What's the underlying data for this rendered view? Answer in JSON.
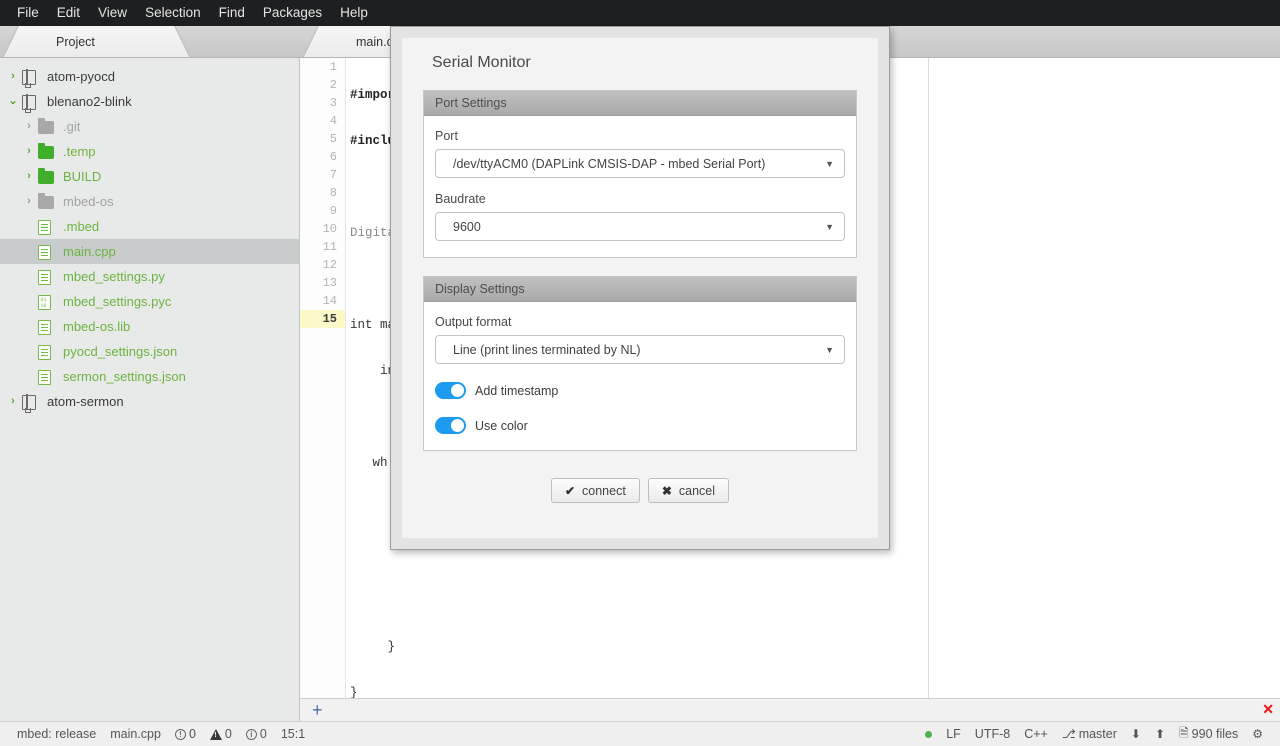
{
  "menubar": {
    "items": [
      {
        "label": "File"
      },
      {
        "label": "Edit"
      },
      {
        "label": "View"
      },
      {
        "label": "Selection"
      },
      {
        "label": "Find"
      },
      {
        "label": "Packages"
      },
      {
        "label": "Help"
      }
    ]
  },
  "left_tab": {
    "label": "Project"
  },
  "editor_tab": {
    "label": "main.cpp"
  },
  "sidebar": {
    "items": [
      {
        "label": "atom-pyocd",
        "icon": "repo-icon",
        "twisty": "›",
        "depth": 0,
        "style": "dark",
        "selected": false
      },
      {
        "label": "blenano2-blink",
        "icon": "repo-icon",
        "twisty": "⌄",
        "depth": 0,
        "style": "dark",
        "selected": false
      },
      {
        "label": ".git",
        "icon": "folder-grey-icon",
        "twisty": "›",
        "depth": 1,
        "style": "grey",
        "selected": false
      },
      {
        "label": ".temp",
        "icon": "folder-icon",
        "twisty": "›",
        "depth": 1,
        "style": "green",
        "selected": false
      },
      {
        "label": "BUILD",
        "icon": "folder-icon",
        "twisty": "›",
        "depth": 1,
        "style": "green",
        "selected": false
      },
      {
        "label": "mbed-os",
        "icon": "folder-grey-icon",
        "twisty": "›",
        "depth": 1,
        "style": "grey",
        "selected": false
      },
      {
        "label": ".mbed",
        "icon": "file-icon",
        "twisty": "",
        "depth": 1,
        "style": "green",
        "selected": false
      },
      {
        "label": "main.cpp",
        "icon": "file-icon",
        "twisty": "",
        "depth": 1,
        "style": "green",
        "selected": true
      },
      {
        "label": "mbed_settings.py",
        "icon": "file-icon",
        "twisty": "",
        "depth": 1,
        "style": "green",
        "selected": false
      },
      {
        "label": "mbed_settings.pyc",
        "icon": "file-binary-icon",
        "twisty": "",
        "depth": 1,
        "style": "green",
        "selected": false
      },
      {
        "label": "mbed-os.lib",
        "icon": "file-icon",
        "twisty": "",
        "depth": 1,
        "style": "green",
        "selected": false
      },
      {
        "label": "pyocd_settings.json",
        "icon": "file-icon",
        "twisty": "",
        "depth": 1,
        "style": "green",
        "selected": false
      },
      {
        "label": "sermon_settings.json",
        "icon": "file-icon",
        "twisty": "",
        "depth": 1,
        "style": "green",
        "selected": false
      },
      {
        "label": "atom-sermon",
        "icon": "repo-icon",
        "twisty": "›",
        "depth": 0,
        "style": "dark",
        "selected": false
      }
    ]
  },
  "editor": {
    "line_numbers": [
      "1",
      "2",
      "3",
      "4",
      "5",
      "6",
      "7",
      "8",
      "9",
      "10",
      "11",
      "12",
      "13",
      "14",
      "15"
    ],
    "active_line": 15,
    "lines": [
      "#impor",
      "#inclu",
      "",
      "Digita",
      "",
      "int ma",
      "    in",
      "",
      "   wh",
      "",
      "",
      "",
      "     }",
      "}",
      ""
    ]
  },
  "bottom_panel": {
    "add_label": "+",
    "close_label": "✕"
  },
  "statusbar": {
    "left": [
      {
        "label": "mbed: release",
        "icon": ""
      },
      {
        "label": "main.cpp",
        "icon": ""
      },
      {
        "label": "0",
        "icon": "error-circle-icon"
      },
      {
        "label": "0",
        "icon": "warning-triangle-icon"
      },
      {
        "label": "0",
        "icon": "info-circle-icon"
      },
      {
        "label": "15:1",
        "icon": ""
      }
    ],
    "right": [
      {
        "label": "",
        "icon": "green-dot-icon"
      },
      {
        "label": "LF",
        "icon": ""
      },
      {
        "label": "UTF-8",
        "icon": ""
      },
      {
        "label": "C++",
        "icon": ""
      },
      {
        "label": "master",
        "icon": "branch-icon"
      },
      {
        "label": "",
        "icon": "arrow-down-icon"
      },
      {
        "label": "",
        "icon": "arrow-up-icon"
      },
      {
        "label": "990 files",
        "icon": "file-count-icon"
      },
      {
        "label": "",
        "icon": "gear-icon"
      }
    ]
  },
  "dialog": {
    "title": "Serial Monitor",
    "port_section": {
      "header": "Port Settings",
      "port_label": "Port",
      "port_value": "/dev/ttyACM0 (DAPLink CMSIS-DAP - mbed Serial Port)",
      "baudrate_label": "Baudrate",
      "baudrate_value": "9600"
    },
    "display_section": {
      "header": "Display Settings",
      "output_format_label": "Output format",
      "output_format_value": "Line (print lines terminated by NL)",
      "add_timestamp_label": "Add timestamp",
      "add_timestamp_on": true,
      "use_color_label": "Use color",
      "use_color_on": true
    },
    "buttons": {
      "connect_label": "connect",
      "connect_glyph": "✔",
      "cancel_label": "cancel",
      "cancel_glyph": "✖"
    }
  },
  "colors": {
    "menubar_bg": "#1d1f21",
    "accent_toggle": "#1d9bf0",
    "tree_green": "#6db33f",
    "folder_green": "#3fae2a",
    "close_red": "#f01010",
    "status_green": "#4caf50",
    "active_line_bg": "#fbf9c8"
  }
}
